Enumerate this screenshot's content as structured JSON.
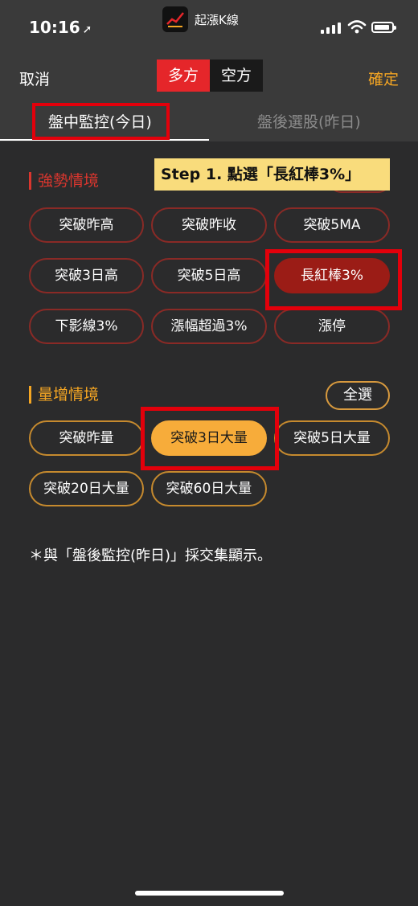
{
  "status_bar": {
    "time": "10:16",
    "location_arrow": "➚",
    "app_name": "起漲K線",
    "app_logo_text": "起漲K線"
  },
  "nav": {
    "cancel": "取消",
    "segments": [
      "多方",
      "空方"
    ],
    "selected_segment": "多方",
    "confirm": "確定"
  },
  "tabs": [
    {
      "label": "盤中監控(今日)",
      "active": true
    },
    {
      "label": "盤後選股(昨日)",
      "active": false
    }
  ],
  "tutorial_banner": "Step 1. 點選「長紅棒3%」",
  "strong_section": {
    "title": "強勢情境",
    "chips": [
      {
        "label": "突破昨高",
        "selected": false
      },
      {
        "label": "突破昨收",
        "selected": false
      },
      {
        "label": "突破5MA",
        "selected": false
      },
      {
        "label": "突破3日高",
        "selected": false
      },
      {
        "label": "突破5日高",
        "selected": false
      },
      {
        "label": "長紅棒3%",
        "selected": true
      },
      {
        "label": "下影線3%",
        "selected": false
      },
      {
        "label": "漲幅超過3%",
        "selected": false
      },
      {
        "label": "漲停",
        "selected": false
      }
    ]
  },
  "volume_section": {
    "title": "量增情境",
    "select_all": "全選",
    "chips": [
      {
        "label": "突破昨量",
        "selected": false
      },
      {
        "label": "突破3日大量",
        "selected": true
      },
      {
        "label": "突破5日大量",
        "selected": false
      },
      {
        "label": "突破20日大量",
        "selected": false
      },
      {
        "label": "突破60日大量",
        "selected": false
      }
    ]
  },
  "footnote": "＊與「盤後監控(昨日)」採交集顯示。",
  "colors": {
    "background": "#2b2b2c",
    "accent_red": "#e5262a",
    "accent_orange": "#f5a623",
    "highlight": "#e3000b"
  }
}
